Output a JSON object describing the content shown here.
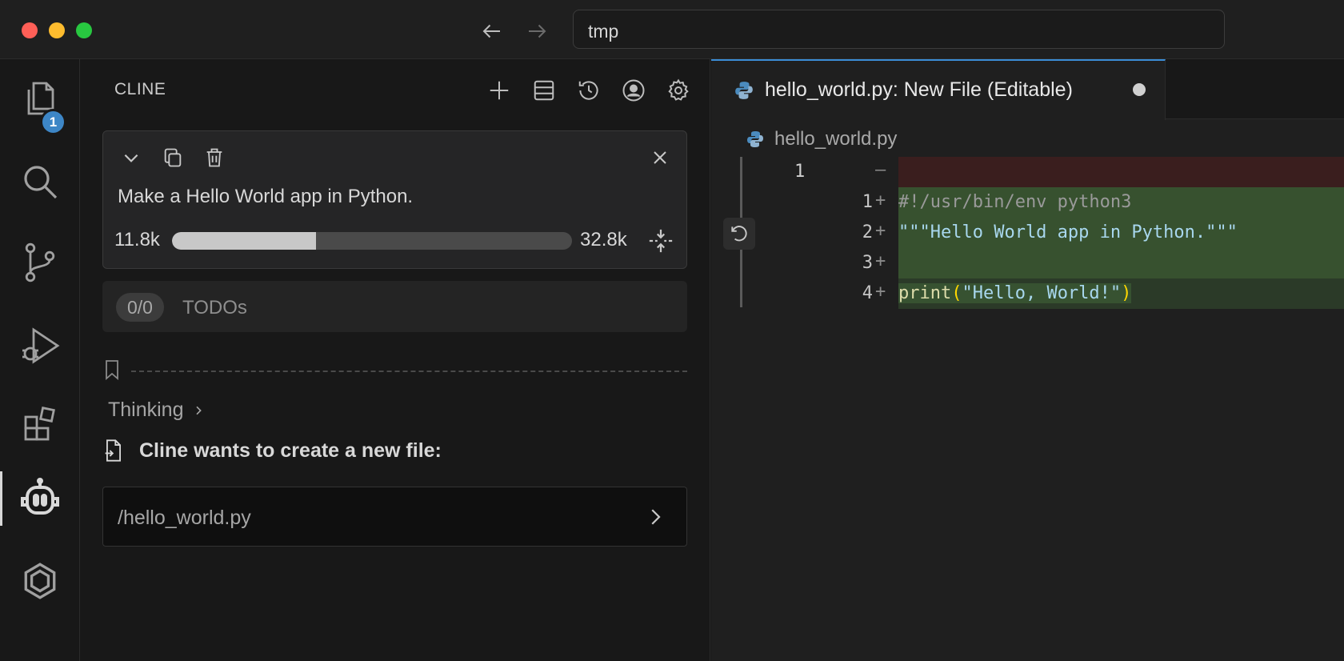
{
  "titlebar": {
    "search_text": "tmp"
  },
  "activity": {
    "explorer_badge": "1"
  },
  "sidebar": {
    "title": "CLINE",
    "task": {
      "text": "Make a Hello World app in Python.",
      "context_used": "11.8k",
      "context_total": "32.8k",
      "context_fraction": 0.36
    },
    "todos": {
      "count": "0/0",
      "label": "TODOs"
    },
    "thinking_label": "Thinking",
    "create_heading": "Cline wants to create a new file:",
    "file_path": "/hello_world.py"
  },
  "editor": {
    "tab_title": "hello_world.py: New File (Editable)",
    "breadcrumb": "hello_world.py",
    "original_line_number": "1",
    "lines": [
      {
        "num": "1",
        "mark": "+",
        "text": "#!/usr/bin/env python3"
      },
      {
        "num": "2",
        "mark": "+",
        "text": "\"\"\"Hello World app in Python.\"\"\""
      },
      {
        "num": "3",
        "mark": "+",
        "text": ""
      },
      {
        "num": "4",
        "mark": "+",
        "text": "print(\"Hello, World!\")"
      }
    ],
    "removed_mark": "—",
    "print_func": "print",
    "print_open": "(",
    "print_arg": "\"Hello, World!\"",
    "print_close": ")"
  },
  "colors": {
    "accent": "#3b8dd6",
    "badge": "#3d86c6",
    "added_bg": "#37512f",
    "removed_bg": "#3a1e1e"
  }
}
